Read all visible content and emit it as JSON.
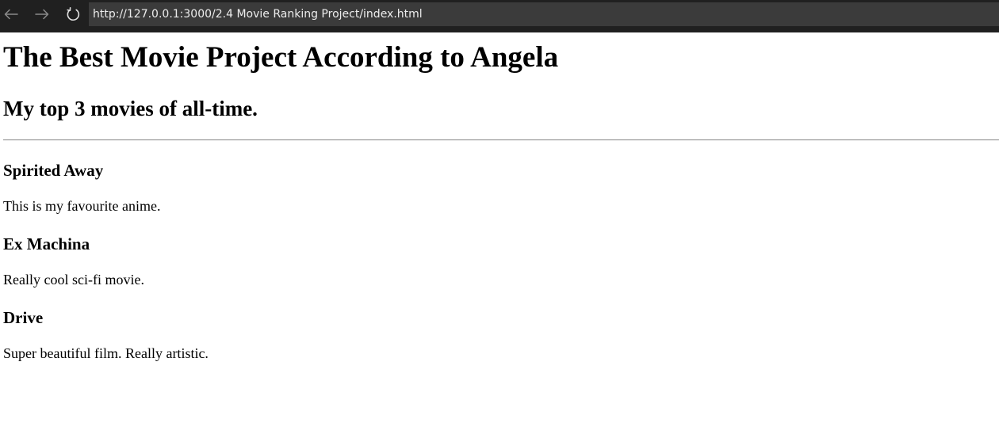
{
  "browser": {
    "url": "http://127.0.0.1:3000/2.4 Movie Ranking Project/index.html",
    "icon_color": "#8a8a8a",
    "reload_icon_color": "#e0e0e0"
  },
  "page": {
    "heading": "The Best Movie Project According to Angela",
    "subheading": "My top 3 movies of all-time.",
    "movies": [
      {
        "title": "Spirited Away",
        "description": "This is my favourite anime."
      },
      {
        "title": "Ex Machina",
        "description": "Really cool sci-fi movie."
      },
      {
        "title": "Drive",
        "description": "Super beautiful film. Really artistic."
      }
    ]
  }
}
